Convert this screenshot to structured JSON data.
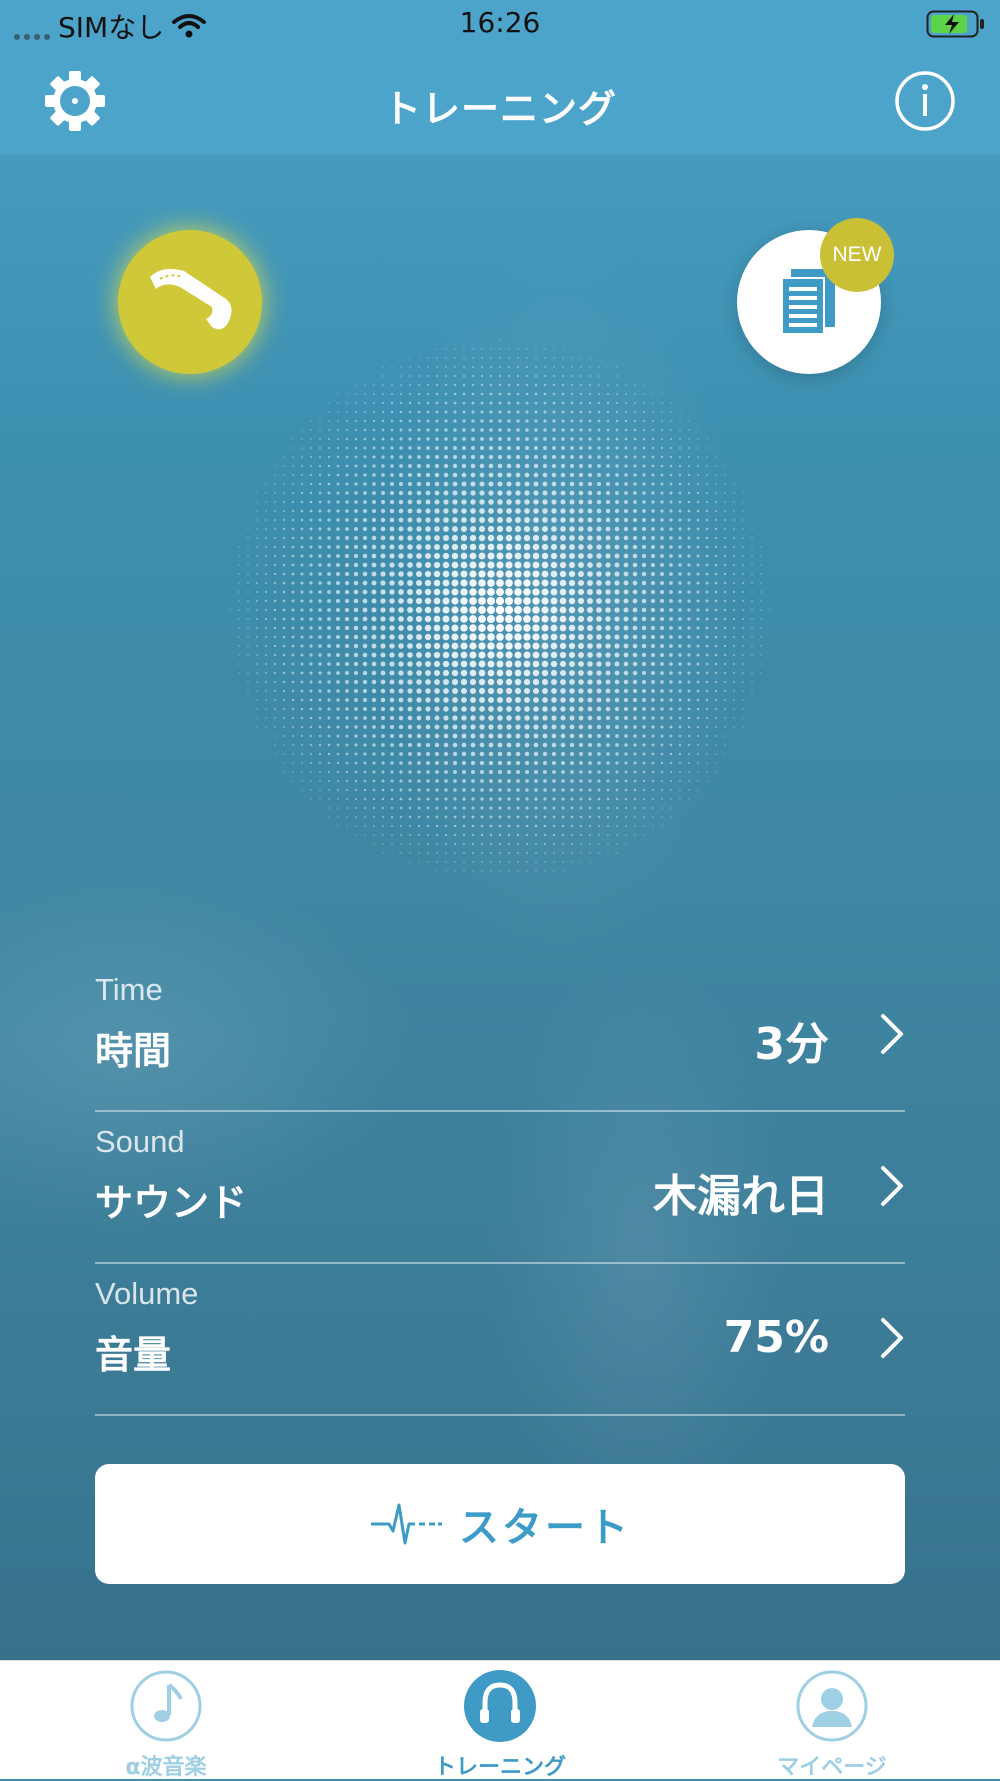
{
  "status_bar": {
    "carrier": "SIMなし",
    "time": "16:26"
  },
  "nav": {
    "title": "トレーニング"
  },
  "badge": {
    "new": "NEW"
  },
  "settings": [
    {
      "en": "Time",
      "jp": "時間",
      "value": "3分"
    },
    {
      "en": "Sound",
      "jp": "サウンド",
      "value": "木漏れ日"
    },
    {
      "en": "Volume",
      "jp": "音量",
      "value": "75%"
    }
  ],
  "start": {
    "label": "スタート"
  },
  "tabs": [
    {
      "label": "α波音楽",
      "icon": "music-note-icon"
    },
    {
      "label": "トレーニング",
      "icon": "headphone-icon"
    },
    {
      "label": "マイページ",
      "icon": "person-icon"
    }
  ],
  "colors": {
    "primary": "#4da4cb",
    "device_accent": "#cfc93a",
    "start_text": "#3d9cc7"
  }
}
